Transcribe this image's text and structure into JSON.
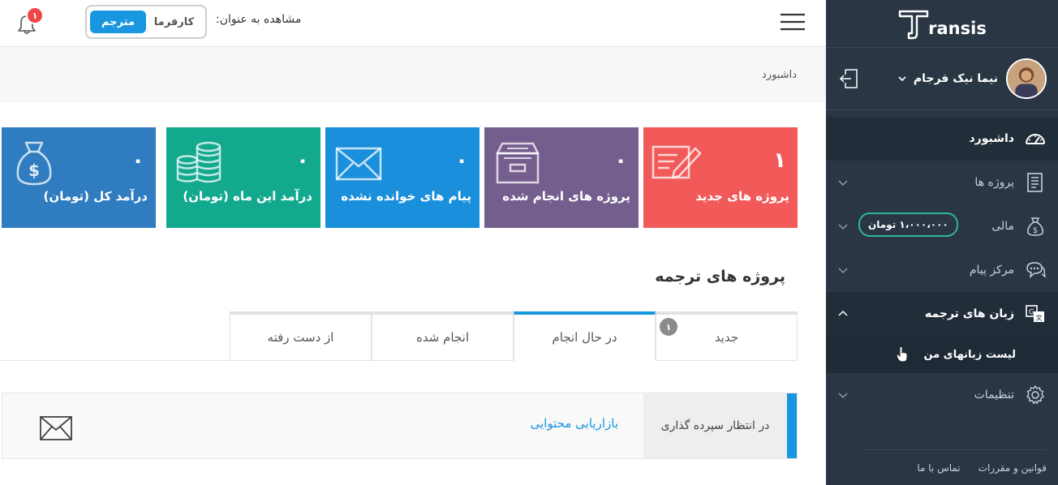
{
  "sidebar": {
    "brand": "ransis",
    "user_name": "نیما نیک فرجام",
    "nav": [
      {
        "label": "داشبورد",
        "icon": "dashboard-gauge-icon"
      },
      {
        "label": "پروژه ها",
        "icon": "document-list-icon"
      },
      {
        "label": "مالی",
        "icon": "money-bag-icon",
        "badge": "۱،۰۰۰،۰۰۰ تومان"
      },
      {
        "label": "مرکز پیام",
        "icon": "chat-bubbles-icon"
      },
      {
        "label": "زبان های ترجمه",
        "icon": "translate-icon"
      },
      {
        "label": "تنظیمات",
        "icon": "gear-icon"
      }
    ],
    "sub_item": "لیست زبانهای من",
    "footer": {
      "rules": "قوانین و مقررات",
      "contact": "تماس با ما"
    }
  },
  "topbar": {
    "role_label": "مشاهده به عنوان:",
    "role_employer": "کارفرما",
    "role_translator": "مترجم",
    "notifications_count": "۱"
  },
  "breadcrumb": "داشبورد",
  "cards": [
    {
      "title": "پروژه های جدید",
      "value": "۱",
      "color": "#f25a5a",
      "icon": "pen-paper-icon"
    },
    {
      "title": "پروژه های انجام شده",
      "value": "۰",
      "color": "#745e8e",
      "icon": "archive-box-icon"
    },
    {
      "title": "پیام های خوانده نشده",
      "value": "۰",
      "color": "#1a8fdc",
      "icon": "envelope-icon"
    },
    {
      "title": "درآمد این ماه (تومان)",
      "value": "۰",
      "color": "#13a98f",
      "icon": "coin-stack-icon"
    },
    {
      "title": "درآمد کل (تومان)",
      "value": "۰",
      "color": "#2f7dc0",
      "icon": "money-bag-icon"
    }
  ],
  "projects": {
    "title": "پروژه های ترجمه",
    "tabs": [
      {
        "label": "جدید",
        "badge": "۱"
      },
      {
        "label": "در حال انجام"
      },
      {
        "label": "انجام شده"
      },
      {
        "label": "از دست رفته"
      }
    ],
    "row": {
      "status": "در انتظار سپرده گذاری",
      "title": "بازاریابی محتوایی"
    }
  }
}
